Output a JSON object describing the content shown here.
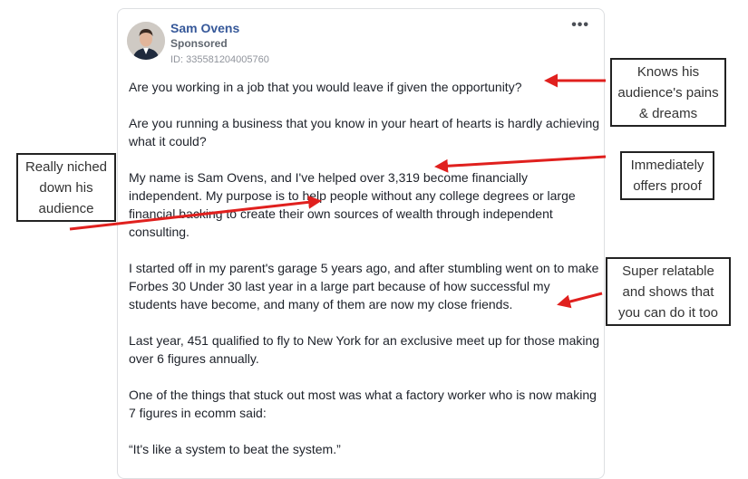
{
  "post": {
    "author": "Sam Ovens",
    "sponsored": "Sponsored",
    "ad_id": "ID: 335581204005760",
    "menu": "•••",
    "paragraphs": [
      "Are you working in a job that you would leave if given the opportunity?",
      "Are you running a business that you know in your heart of hearts is hardly achieving what it could?",
      "My name is Sam Ovens, and I've helped over 3,319 become financially independent. My purpose is to help people without any college degrees or large financial backing to create their own sources of wealth through independent consulting.",
      "I started off in my parent's garage 5 years ago, and after stumbling went on to make Forbes 30 Under 30 last year in a large part because of how successful my students have become, and many of them are now my close friends.",
      "Last year, 451 qualified to fly to New York for an exclusive meet up for those making over 6 figures annually.",
      "One of the things that stuck out most was what a factory worker who is now making 7 figures in ecomm said:",
      "“It's like a system to beat the system.”"
    ]
  },
  "annotations": {
    "pains": "Knows his audience's pains & dreams",
    "proof": "Immediately offers proof",
    "niched": "Really niched down his audience",
    "relatable": "Super relatable and shows that you can do it too"
  },
  "colors": {
    "arrow": "#e0201e",
    "name": "#365899"
  }
}
